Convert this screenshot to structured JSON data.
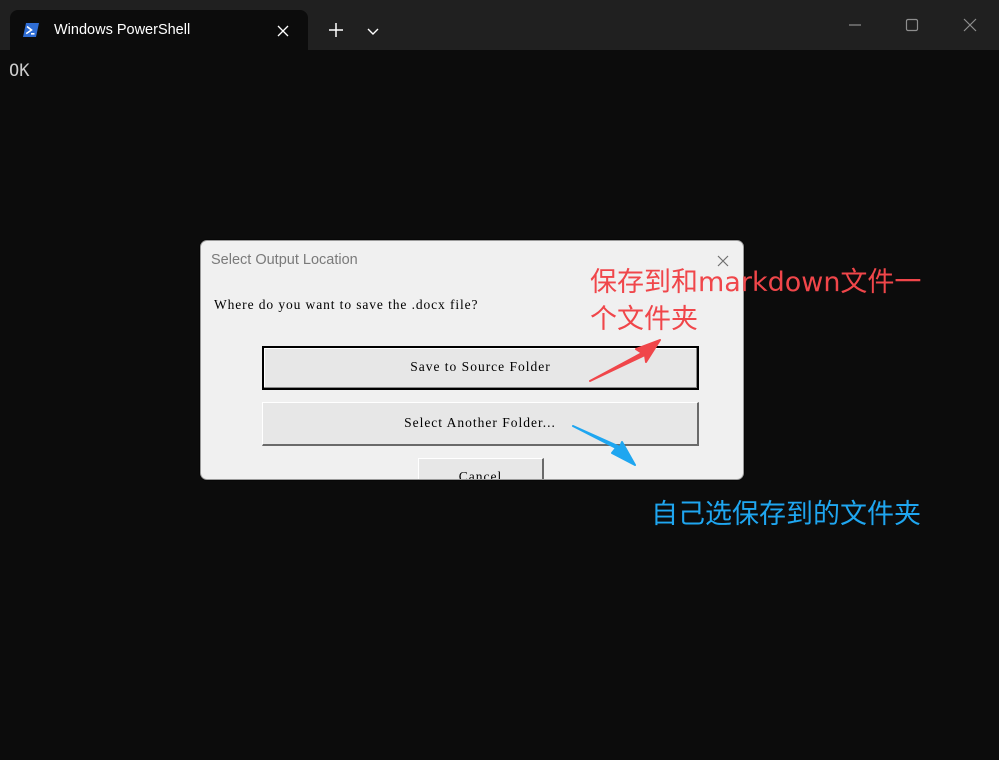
{
  "window": {
    "tab_title": "Windows PowerShell",
    "tab_icon": "powershell-icon",
    "new_tab_icon": "plus-icon",
    "dropdown_icon": "chevron-down-icon",
    "controls": [
      "minimize-icon",
      "maximize-icon",
      "close-icon"
    ]
  },
  "terminal": {
    "output": "OK"
  },
  "dialog": {
    "title": "Select Output Location",
    "question": "Where do you want to save the .docx file?",
    "buttons": {
      "save_source": "Save to Source Folder",
      "select_another": "Select Another Folder...",
      "cancel": "Cancel"
    }
  },
  "annotations": {
    "red_text": "保存到和markdown文件一个文件夹",
    "blue_text": "自己选保存到的文件夹",
    "red_color": "#f0464a",
    "blue_color": "#1fa6f0"
  },
  "colors": {
    "terminal_bg": "#0c0c0c",
    "titlebar_bg": "#202020",
    "dialog_bg": "#f0f0f0"
  }
}
